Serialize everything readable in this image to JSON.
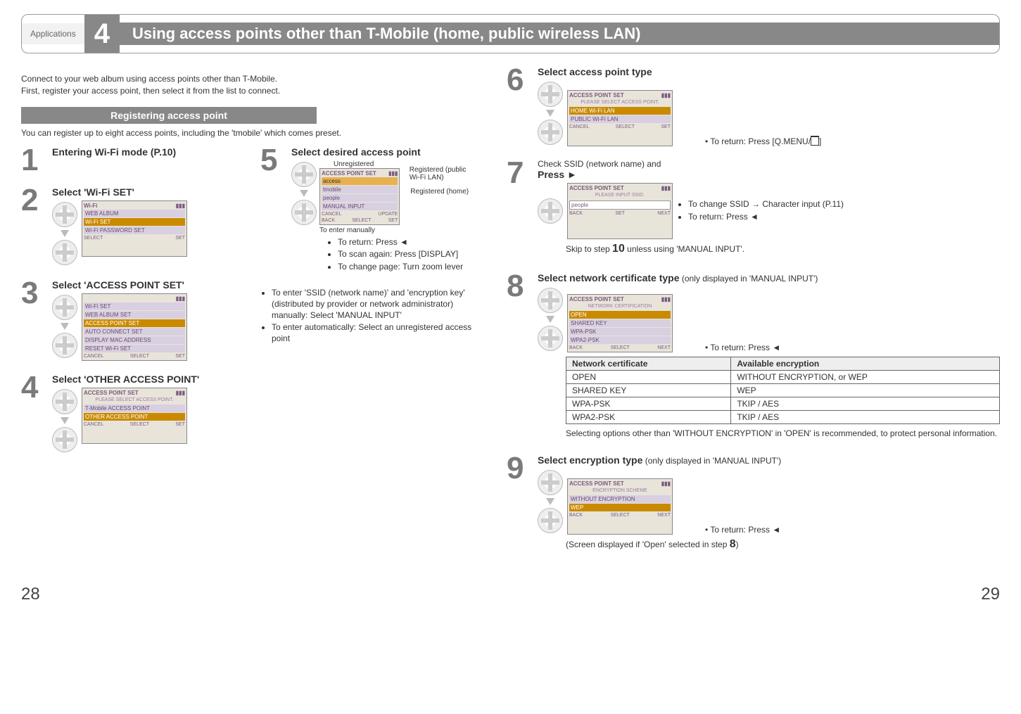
{
  "header": {
    "tab": "Applications",
    "number": "4",
    "title": "Using access points other than T-Mobile (home, public wireless LAN)"
  },
  "intro_line1": "Connect to your web album using access points other than T-Mobile.",
  "intro_line2": "First, register your access point, then select it from the list to connect.",
  "section_bar": "Registering access point",
  "subintro": "You can register up to eight access points, including the 'tmobile' which comes preset.",
  "steps": {
    "s1": {
      "num": "1",
      "title": "Entering Wi-Fi mode (P.10)"
    },
    "s2": {
      "num": "2",
      "title": "Select 'Wi-Fi SET'",
      "screen": {
        "title": "Wi-Fi",
        "rows": [
          "WEB ALBUM",
          "Wi-Fi SET",
          "Wi-Fi PASSWORD SET"
        ],
        "footer_l": "SELECT",
        "footer_r": "SET"
      }
    },
    "s3": {
      "num": "3",
      "title": "Select 'ACCESS POINT SET'",
      "screen": {
        "rows": [
          "Wi-Fi SET",
          "WEB ALBUM SET",
          "ACCESS POINT SET",
          "AUTO CONNECT SET",
          "DISPLAY MAC ADDRESS",
          "RESET Wi-Fi SET"
        ],
        "footer_l": "CANCEL",
        "footer_m": "SELECT",
        "footer_r": "SET"
      }
    },
    "s4": {
      "num": "4",
      "title": "Select 'OTHER ACCESS POINT'",
      "screen": {
        "title": "ACCESS POINT SET",
        "msg": "PLEASE SELECT ACCESS POINT.",
        "rows": [
          "T-Mobile ACCESS POINT",
          "OTHER ACCESS POINT"
        ],
        "footer_l": "CANCEL",
        "footer_m": "SELECT",
        "footer_r": "SET"
      }
    },
    "s5": {
      "num": "5",
      "title": "Select desired access point",
      "annot_top": "Unregistered",
      "annot_r1": "Registered (public Wi-Fi LAN)",
      "annot_r2": "Registered (home)",
      "annot_bottom": "To enter manually",
      "screen": {
        "title": "ACCESS POINT SET",
        "rows": [
          "access",
          "tmobile",
          "people",
          "MANUAL INPUT"
        ],
        "footer_l": "CANCEL",
        "footer_m": "UPDATE",
        "footer_b": "BACK",
        "footer_s": "SELECT",
        "footer_r": "SET"
      },
      "bullets": [
        "To return: Press ◄",
        "To scan again: Press [DISPLAY]",
        "To change page: Turn zoom lever"
      ],
      "notes": [
        "To enter 'SSID (network name)' and 'encryption key' (distributed by provider or network administrator) manually: Select 'MANUAL INPUT'",
        "To enter automatically: Select an unregistered access point"
      ]
    },
    "s6": {
      "num": "6",
      "title": "Select access point type",
      "screen": {
        "title": "ACCESS POINT SET",
        "msg": "PLEASE SELECT ACCESS POINT.",
        "rows": [
          "HOME Wi-Fi LAN",
          "PUBLIC Wi-Fi LAN"
        ],
        "footer_l": "CANCEL",
        "footer_m": "SELECT",
        "footer_r": "SET"
      },
      "bullet": "To return: Press [Q.MENU/",
      "bullet_suffix": "]"
    },
    "s7": {
      "num": "7",
      "pretitle": "Check SSID (network name) and",
      "title": "Press ►",
      "screen": {
        "title": "ACCESS POINT SET",
        "msg": "PLEASE INPUT SSID.",
        "input": "people",
        "footer_l": "BACK",
        "footer_m": "SET",
        "footer_r": "NEXT"
      },
      "bullets": [
        "To change SSID → Character input (P.11)",
        "To return: Press ◄"
      ],
      "skip_a": "Skip to step ",
      "skip_num": "10",
      "skip_b": " unless using 'MANUAL INPUT'."
    },
    "s8": {
      "num": "8",
      "title": "Select network certificate type",
      "title_note": " (only displayed in 'MANUAL INPUT')",
      "screen": {
        "title": "ACCESS POINT SET",
        "subtitle": "NETWORK CERTIFICATION",
        "rows": [
          "OPEN",
          "SHARED KEY",
          "WPA-PSK",
          "WPA2-PSK"
        ],
        "footer_l": "BACK",
        "footer_m": "SELECT",
        "footer_r": "NEXT"
      },
      "bullet": "To return: Press ◄",
      "table": {
        "head": [
          "Network certificate",
          "Available encryption"
        ],
        "rows": [
          [
            "OPEN",
            "WITHOUT ENCRYPTION, or WEP"
          ],
          [
            "SHARED KEY",
            "WEP"
          ],
          [
            "WPA-PSK",
            "TKIP / AES"
          ],
          [
            "WPA2-PSK",
            "TKIP / AES"
          ]
        ]
      },
      "note": "Selecting options other than 'WITHOUT ENCRYPTION' in 'OPEN' is recommended, to protect personal information."
    },
    "s9": {
      "num": "9",
      "title": "Select encryption type",
      "title_note": " (only displayed in 'MANUAL INPUT')",
      "screen": {
        "title": "ACCESS POINT SET",
        "subtitle": "ENCRYPTION SCHEME",
        "rows": [
          "WITHOUT ENCRYPTION",
          "WEP"
        ],
        "footer_l": "BACK",
        "footer_m": "SELECT",
        "footer_r": "NEXT"
      },
      "bullet": "To return: Press ◄",
      "note_a": "(Screen displayed if 'Open' selected in step ",
      "note_num": "8",
      "note_b": ")"
    }
  },
  "page_left": "28",
  "page_right": "29"
}
